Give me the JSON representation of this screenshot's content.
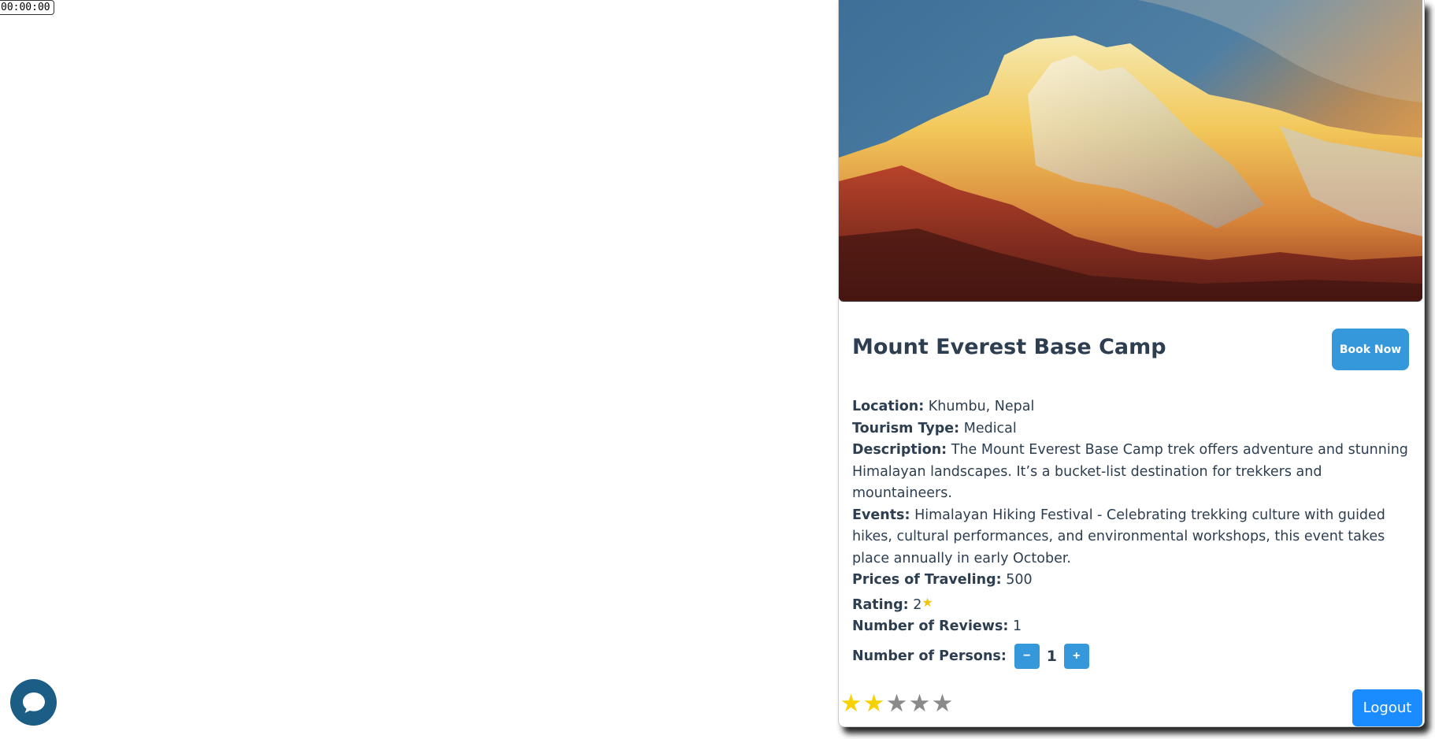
{
  "timer": {
    "text": "00:00:00"
  },
  "destination": {
    "title": "Mount Everest Base Camp",
    "book_label": "Book Now",
    "location_label": "Location:",
    "location": "Khumbu, Nepal",
    "tourism_type_label": "Tourism Type:",
    "tourism_type": "Medical",
    "description_label": "Description:",
    "description": "The Mount Everest Base Camp trek offers adventure and stunning Himalayan landscapes. It’s a bucket-list destination for trekkers and mountaineers.",
    "events_label": "Events:",
    "events": "Himalayan Hiking Festival - Celebrating trekking culture with guided hikes, cultural performances, and environmental workshops, this event takes place annually in early October.",
    "price_label": "Prices of Traveling:",
    "price": "500",
    "rating_label": "Rating:",
    "rating": "2",
    "reviews_label": "Number of Reviews:",
    "reviews": "1"
  },
  "persons": {
    "label": "Number of Persons:",
    "decrement": "−",
    "count": "1",
    "increment": "+"
  },
  "user_rating": {
    "filled": 2,
    "max": 5
  },
  "logout_label": "Logout",
  "icons": {
    "chat": "chat-bubble-icon",
    "star": "star-icon",
    "image": "mountain-photo"
  },
  "colors": {
    "primary": "#3498db",
    "logout": "#1a8cff",
    "chat": "#1b5d85",
    "star_on": "#f7d100",
    "star_off": "#8a8a8a",
    "text": "#2c3e50"
  }
}
